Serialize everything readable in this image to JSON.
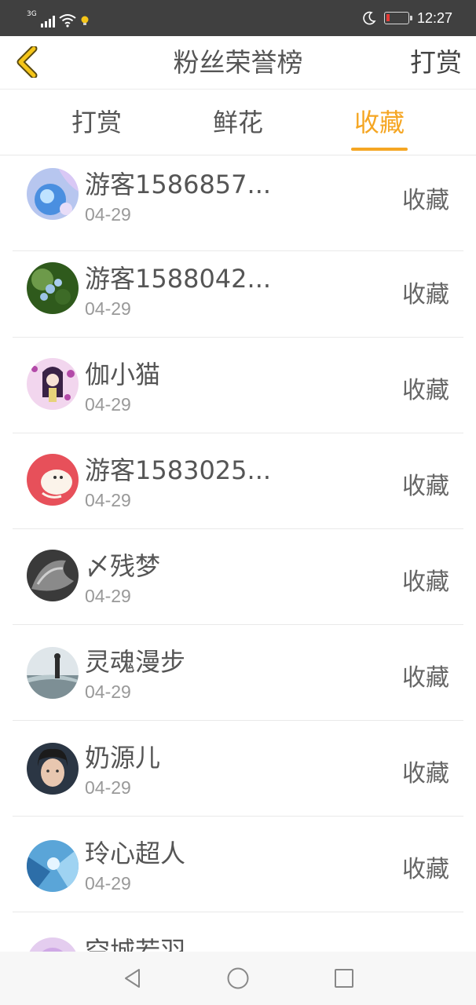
{
  "status_bar": {
    "network": "3G",
    "time": "12:27",
    "icons": [
      "signal-icon",
      "wifi-icon",
      "bulb-icon",
      "moon-icon",
      "battery-icon"
    ],
    "battery_color": "#e53935"
  },
  "header": {
    "back_icon": "chevron-left-icon",
    "title": "粉丝荣誉榜",
    "action_label": "打赏",
    "back_color": "#f5c518"
  },
  "tabs": [
    {
      "label": "打赏",
      "active": false
    },
    {
      "label": "鲜花",
      "active": false
    },
    {
      "label": "收藏",
      "active": true
    }
  ],
  "accent_color": "#f5a623",
  "fans": [
    {
      "name": "游客1586857...",
      "date": "04-29",
      "action": "收藏"
    },
    {
      "name": "游客1588042...",
      "date": "04-29",
      "action": "收藏"
    },
    {
      "name": "伽小猫",
      "date": "04-29",
      "action": "收藏"
    },
    {
      "name": "游客1583025...",
      "date": "04-29",
      "action": "收藏"
    },
    {
      "name": "〆残梦",
      "date": "04-29",
      "action": "收藏"
    },
    {
      "name": "灵魂漫步",
      "date": "04-29",
      "action": "收藏"
    },
    {
      "name": "奶源儿",
      "date": "04-29",
      "action": "收藏"
    },
    {
      "name": "玲心超人",
      "date": "04-29",
      "action": "收藏"
    },
    {
      "name": "空城若羽",
      "date": "",
      "action": ""
    }
  ],
  "nav_bar": {
    "icons": [
      "back-triangle-icon",
      "home-circle-icon",
      "recent-square-icon"
    ]
  }
}
